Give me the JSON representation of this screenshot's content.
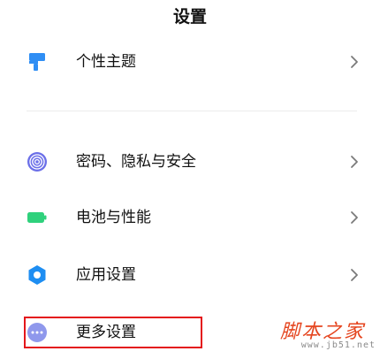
{
  "header": {
    "title": "设置"
  },
  "items": [
    {
      "label": "个性主题",
      "icon": "brush-icon",
      "color": "#2f8ef4"
    },
    {
      "label": "密码、隐私与安全",
      "icon": "fingerprint-icon",
      "color": "#6b6fe8"
    },
    {
      "label": "电池与性能",
      "icon": "battery-icon",
      "color": "#2fd17c"
    },
    {
      "label": "应用设置",
      "icon": "gear-icon",
      "color": "#1e8ef2"
    },
    {
      "label": "更多设置",
      "icon": "more-icon",
      "color": "#8f98ec"
    }
  ],
  "highlight_color": "#e4161b",
  "watermark": {
    "main": "脚本之家",
    "sub": "www.jb51.net"
  }
}
